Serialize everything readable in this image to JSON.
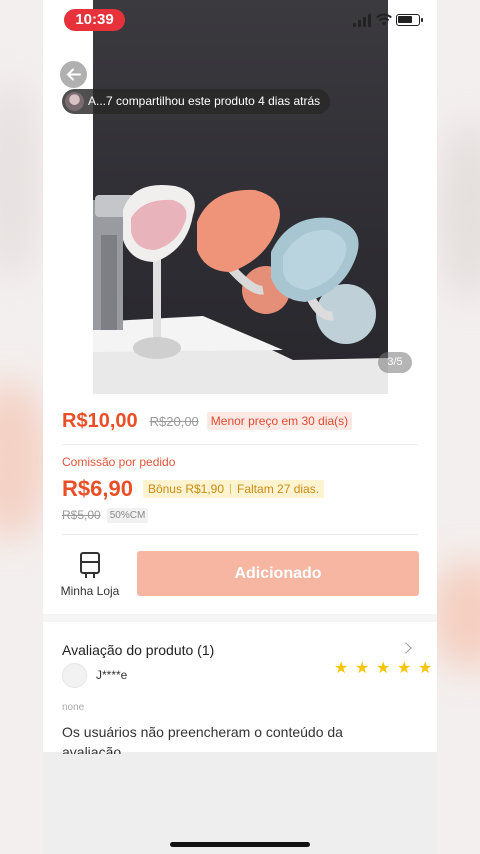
{
  "status_bar": {
    "time": "10:39"
  },
  "product": {
    "share_banner": "A...7 compartilhou este produto 4 dias atrás",
    "image_counter": "3/5",
    "price": "R$10,00",
    "original_price": "R$20,00",
    "price_badge": "Menor preço em 30 dia(s)"
  },
  "commission": {
    "label": "Comissão por pedido",
    "value": "R$6,90",
    "bonus": "Bônus R$1,90",
    "days_left": "Faltam 27 dias.",
    "old_value": "R$5,00",
    "rate_badge": "50%CM"
  },
  "actions": {
    "store_label": "Minha Loja",
    "add_label": "Adicionado"
  },
  "review": {
    "title": "Avaliação do produto (1)",
    "reviewer": "J****e",
    "rating": 5,
    "variant": "none",
    "text": "Os usuários não preencheram o conteúdo da avaliação"
  },
  "colors": {
    "accent": "#ea4f28",
    "add_button": "#f7b6a2",
    "time_pill": "#e8323b",
    "star": "#f7c600"
  }
}
